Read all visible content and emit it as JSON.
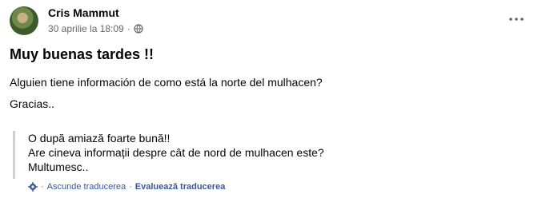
{
  "post": {
    "author": "Cris Mammut",
    "timestamp": "30 aprilie la 18:09",
    "separator": "·",
    "privacy_icon": "globe-icon",
    "more_icon": "more-options-icon",
    "title": "Muy buenas tardes !!",
    "body_line1": "Alguien tiene información de como está la norte del mulhacen?",
    "body_line2": "Gracias.."
  },
  "translation": {
    "lines": [
      "O după amiază foarte bună!!",
      "Are cineva informații despre cât de nord de mulhacen este?",
      "Multumesc.."
    ],
    "hide_label": "Ascunde traducerea",
    "separator": "·",
    "rate_label": "Evaluează traducerea",
    "icon": "gear-icon"
  },
  "colors": {
    "text": "#050505",
    "secondary": "#65676b",
    "link": "#385898",
    "border": "#ced0d4"
  }
}
